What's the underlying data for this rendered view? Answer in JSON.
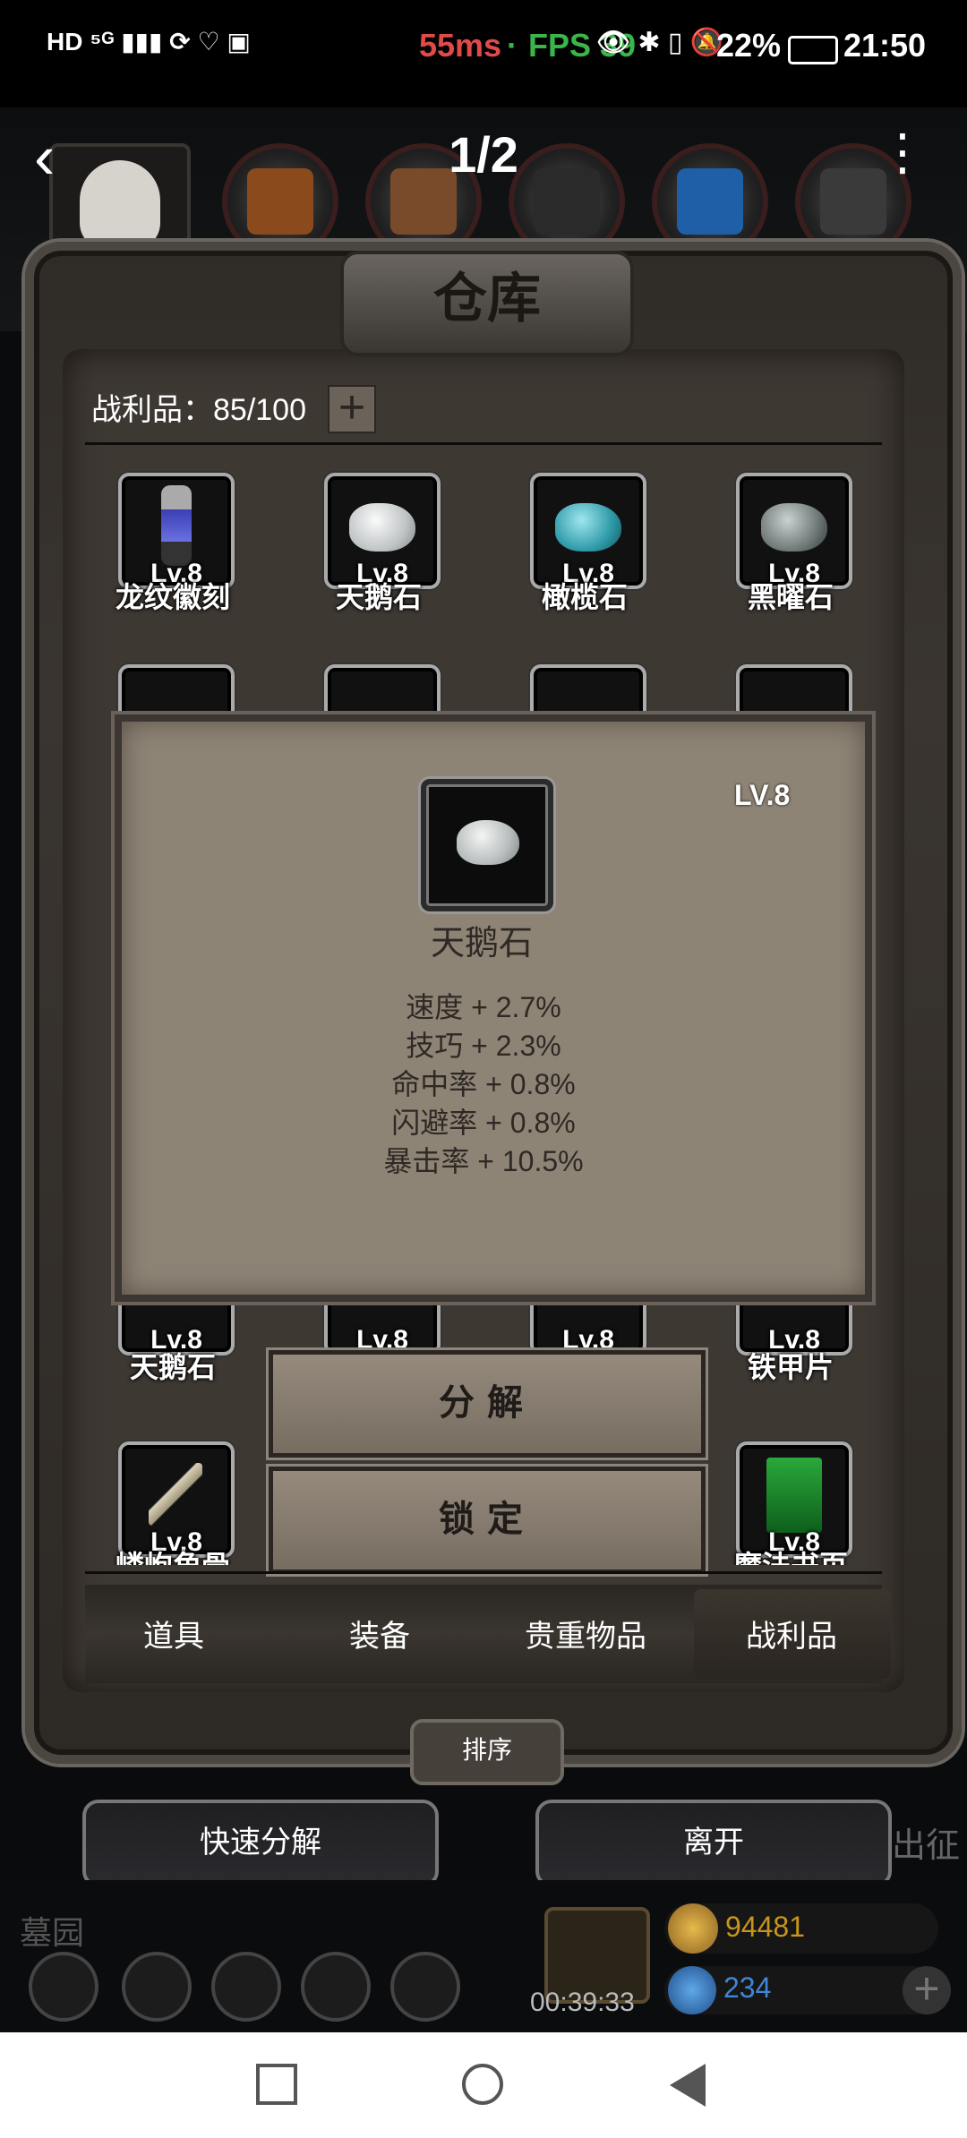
{
  "status_bar": {
    "left_icons": [
      "HD",
      "5G",
      "signal-icon",
      "sync-icon",
      "link-icon",
      "app-icon"
    ],
    "latency": "55ms",
    "fps": "FPS 39",
    "battery": "22%",
    "time": "21:50"
  },
  "header": {
    "page_indicator": "1/2",
    "back_icon": "chevron-left-icon",
    "more_icon": "more-vertical-icon"
  },
  "warehouse": {
    "title": "仓库",
    "capacity_label": "战利品：85/100",
    "add_label": "+",
    "items_row1": [
      {
        "name": "龙纹徽刻",
        "level": "Lv.8"
      },
      {
        "name": "天鹅石",
        "level": "Lv.8"
      },
      {
        "name": "橄榄石",
        "level": "Lv.8"
      },
      {
        "name": "黑曜石",
        "level": "Lv.8"
      }
    ],
    "items_row3": [
      {
        "name": "天鹅石",
        "level": "Lv.8"
      },
      {
        "name": "",
        "level": "Lv.8"
      },
      {
        "name": "",
        "level": "Lv.8"
      },
      {
        "name": "铁甲片",
        "level": "Lv.8"
      }
    ],
    "items_row4": [
      {
        "name": "嶙峋角骨",
        "level": "Lv.8"
      },
      {
        "name": "魔法书页",
        "level": "Lv.8"
      }
    ]
  },
  "popup": {
    "level": "LV.8",
    "name": "天鹅石",
    "stats": [
      "速度 + 2.7%",
      "技巧 + 2.3%",
      "命中率 + 0.8%",
      "闪避率 + 0.8%",
      "暴击率 + 10.5%"
    ]
  },
  "actions": {
    "decompose": "分解",
    "lock": "锁定"
  },
  "tabs": [
    "道具",
    "装备",
    "贵重物品",
    "战利品"
  ],
  "sort_label": "排序",
  "bottom_buttons": {
    "quick_decompose": "快速分解",
    "leave": "离开"
  },
  "hud": {
    "location": "墓园",
    "timer": "00:39:33",
    "gold": "94481",
    "gems": "234",
    "march": "出征"
  },
  "colors": {
    "latency": "#e24a4a",
    "fps": "#3ab54a",
    "gold": "#c8951c",
    "gems": "#3f86d6"
  }
}
